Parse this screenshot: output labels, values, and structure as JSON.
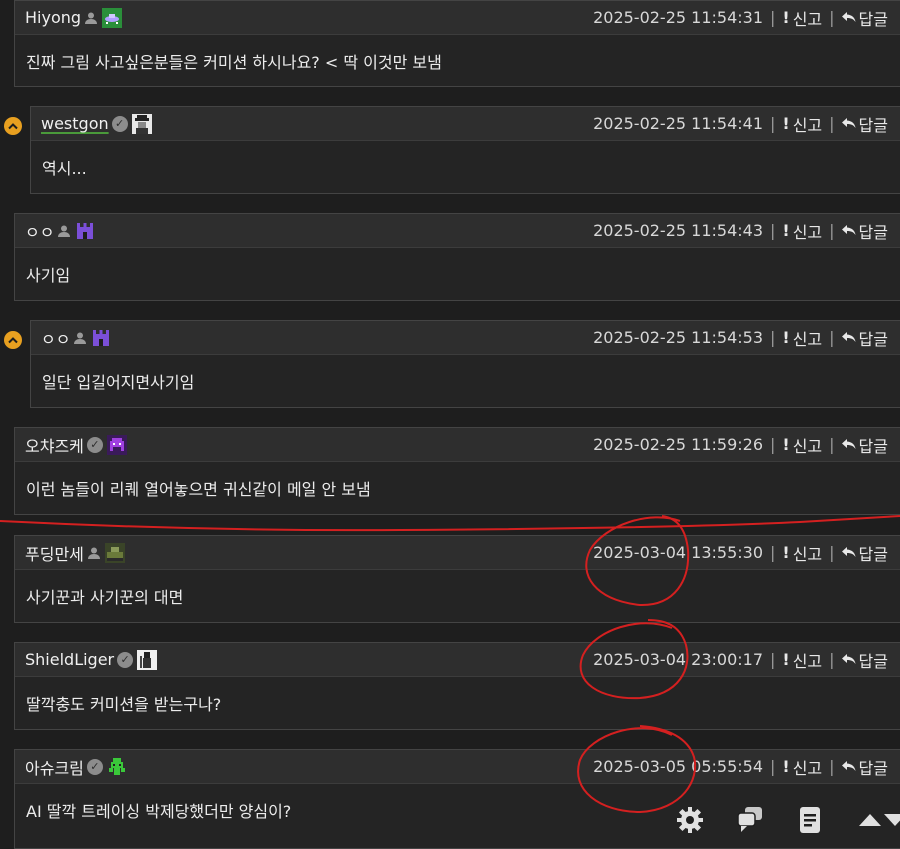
{
  "comments": [
    {
      "author": "Hiyong",
      "verified": false,
      "badge": "ufo-badge",
      "badge_color": "#2a8f3a",
      "time": "2025-02-25 11:54:31",
      "report": "신고",
      "reply": "답글",
      "text": "진짜 그림 사고싶은분들은 커미션 하시나요? < 딱 이것만 보냄",
      "is_reply": false
    },
    {
      "author": "westgon",
      "verified": true,
      "badge": "spy-badge",
      "badge_color": "#dcdcdc",
      "time": "2025-02-25 11:54:41",
      "report": "신고",
      "reply": "답글",
      "text": "역시...",
      "is_reply": true
    },
    {
      "author": "ㅇㅇ",
      "verified": false,
      "badge": "castle-badge",
      "badge_color": "#7b4fd8",
      "time": "2025-02-25 11:54:43",
      "report": "신고",
      "reply": "답글",
      "text": "사기임",
      "is_reply": false
    },
    {
      "author": "ㅇㅇ",
      "verified": false,
      "badge": "castle-badge",
      "badge_color": "#7b4fd8",
      "time": "2025-02-25 11:54:53",
      "report": "신고",
      "reply": "답글",
      "text": "일단 입길어지면사기임",
      "is_reply": true
    },
    {
      "author": "오챠즈케",
      "verified": true,
      "badge": "invader-badge",
      "badge_color": "#7a2fb8",
      "time": "2025-02-25 11:59:26",
      "report": "신고",
      "reply": "답글",
      "text": "이런 놈들이 리퀘 열어놓으면 귀신같이 메일 안 보냄",
      "is_reply": false
    },
    {
      "author": "푸딩만세",
      "verified": false,
      "badge": "tank-badge",
      "badge_color": "#5a6e3a",
      "time": "2025-03-04 13:55:30",
      "report": "신고",
      "reply": "답글",
      "text": "사기꾼과 사기꾼의 대면",
      "is_reply": false
    },
    {
      "author": "ShieldLiger",
      "verified": true,
      "badge": "knight-badge",
      "badge_color": "#f0f0f0",
      "time": "2025-03-04 23:00:17",
      "report": "신고",
      "reply": "답글",
      "text": "딸깍충도 커미션을 받는구나?",
      "is_reply": false
    },
    {
      "author": "아슈크림",
      "verified": true,
      "badge": "alien-badge",
      "badge_color": "#3ac83a",
      "time": "2025-03-05 05:55:54",
      "report": "신고",
      "reply": "답글",
      "text": "AI 딸깍 트레이싱 박제당했더만 양심이?",
      "is_reply": false
    }
  ],
  "toolbar": {
    "icons": [
      "gear-icon",
      "comments-icon",
      "document-icon",
      "scroll-up-icon",
      "scroll-down-icon"
    ]
  },
  "colors": {
    "reply_indicator": "#e8a020",
    "annotation": "#d42020"
  }
}
